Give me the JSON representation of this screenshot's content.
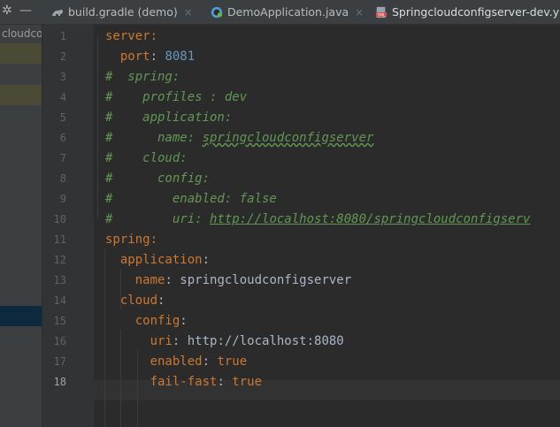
{
  "tabs": [
    {
      "label": "build.gradle (demo)",
      "icon": "gradle-icon",
      "color": "#9aa4ad"
    },
    {
      "label": "DemoApplication.java",
      "icon": "spring-boot-icon",
      "color": "#4a9fd8"
    },
    {
      "label": "Springcloudconfigserver-dev.y",
      "icon": "yaml-file-icon",
      "color": "#c75450"
    }
  ],
  "project_panel": {
    "label": "cloudcon"
  },
  "current_line": 18,
  "lines": [
    [
      {
        "t": "server:",
        "c": "k"
      }
    ],
    [
      {
        "t": "  ",
        "c": "v"
      },
      {
        "t": "port",
        "c": "k"
      },
      {
        "t": ": ",
        "c": "v"
      },
      {
        "t": "8081",
        "c": "n"
      }
    ],
    [
      {
        "t": "#  spring:",
        "c": "c"
      }
    ],
    [
      {
        "t": "#    profiles : dev",
        "c": "c"
      }
    ],
    [
      {
        "t": "#    application:",
        "c": "c"
      }
    ],
    [
      {
        "t": "#      name: ",
        "c": "c"
      },
      {
        "t": "springcloudconfigserver",
        "c": "wavy"
      }
    ],
    [
      {
        "t": "#    cloud:",
        "c": "c"
      }
    ],
    [
      {
        "t": "#      config:",
        "c": "c"
      }
    ],
    [
      {
        "t": "#        enabled: false",
        "c": "c"
      }
    ],
    [
      {
        "t": "#        uri: ",
        "c": "c"
      },
      {
        "t": "http://localhost:8080/springcloudconfigserv",
        "c": "u"
      }
    ],
    [
      {
        "t": "spring:",
        "c": "k"
      }
    ],
    [
      {
        "t": "  ",
        "c": "v"
      },
      {
        "t": "application",
        "c": "k"
      },
      {
        "t": ":",
        "c": "v"
      }
    ],
    [
      {
        "t": "    ",
        "c": "v"
      },
      {
        "t": "name",
        "c": "k"
      },
      {
        "t": ": springcloudconfigserver",
        "c": "v"
      }
    ],
    [
      {
        "t": "  ",
        "c": "v"
      },
      {
        "t": "cloud",
        "c": "k"
      },
      {
        "t": ":",
        "c": "v"
      }
    ],
    [
      {
        "t": "    ",
        "c": "v"
      },
      {
        "t": "config",
        "c": "k"
      },
      {
        "t": ":",
        "c": "v"
      }
    ],
    [
      {
        "t": "      ",
        "c": "v"
      },
      {
        "t": "uri",
        "c": "k"
      },
      {
        "t": ": http://localhost:8080",
        "c": "v"
      }
    ],
    [
      {
        "t": "      ",
        "c": "v"
      },
      {
        "t": "enabled",
        "c": "k"
      },
      {
        "t": ": ",
        "c": "v"
      },
      {
        "t": "true",
        "c": "k"
      }
    ],
    [
      {
        "t": "      ",
        "c": "v"
      },
      {
        "t": "fail-fast",
        "c": "k"
      },
      {
        "t": ": ",
        "c": "v"
      },
      {
        "t": "true",
        "c": "k"
      }
    ]
  ]
}
